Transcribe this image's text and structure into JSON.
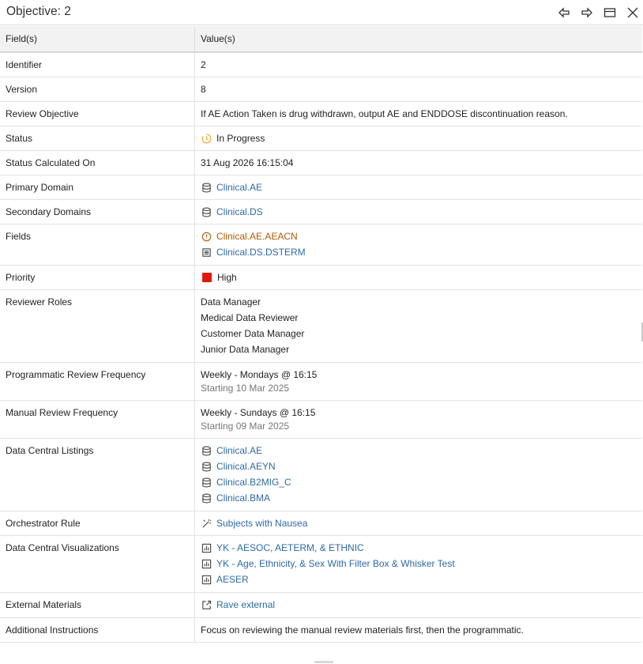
{
  "panel": {
    "title": "Objective: 2"
  },
  "table": {
    "header_field": "Field(s)",
    "header_value": "Value(s)",
    "identifier": {
      "label": "Identifier",
      "value": "2"
    },
    "version": {
      "label": "Version",
      "value": "8"
    },
    "review_objective": {
      "label": "Review Objective",
      "value": "If AE Action Taken is drug withdrawn, output AE and ENDDOSE discontinuation reason."
    },
    "status": {
      "label": "Status",
      "value": "In Progress",
      "icon": "in-progress-clock-icon",
      "color": "#f0a020"
    },
    "status_calculated": {
      "label": "Status Calculated On",
      "value": "31 Aug 2026 16:15:04"
    },
    "primary_domain": {
      "label": "Primary Domain",
      "value": "Clinical.AE",
      "icon": "database-icon"
    },
    "secondary_domains": {
      "label": "Secondary Domains",
      "value": "Clinical.DS",
      "icon": "database-icon"
    },
    "fields": {
      "label": "Fields",
      "items": [
        {
          "value": "Clinical.AE.AEACN",
          "icon": "warning-circle-icon",
          "color": "#b25a00"
        },
        {
          "value": "Clinical.DS.DSTERM",
          "icon": "field-list-icon",
          "color": "#2e6aa6"
        }
      ]
    },
    "priority": {
      "label": "Priority",
      "value": "High",
      "color": "#e0190f"
    },
    "reviewer_roles": {
      "label": "Reviewer Roles",
      "items": [
        "Data Manager",
        "Medical Data Reviewer",
        "Customer Data Manager",
        "Junior Data Manager"
      ]
    },
    "programmatic_frequency": {
      "label": "Programmatic Review Frequency",
      "value": "Weekly - Mondays @ 16:15",
      "sub": "Starting 10 Mar 2025"
    },
    "manual_frequency": {
      "label": "Manual Review Frequency",
      "value": "Weekly - Sundays @ 16:15",
      "sub": "Starting 09 Mar 2025"
    },
    "listings": {
      "label": "Data Central Listings",
      "items": [
        "Clinical.AE",
        "Clinical.AEYN",
        "Clinical.B2MIG_C",
        "Clinical.BMA"
      ]
    },
    "orchestrator_rule": {
      "label": "Orchestrator Rule",
      "value": "Subjects with Nausea",
      "icon": "magic-wand-icon"
    },
    "visualizations": {
      "label": "Data Central Visualizations",
      "items": [
        "YK - AESOC, AETERM, & ETHNIC",
        "YK - Age, Ethnicity, & Sex With Filter Box & Whisker Test",
        "AESER"
      ]
    },
    "external_materials": {
      "label": "External Materials",
      "value": "Rave external",
      "icon": "external-link-icon"
    },
    "additional_instructions": {
      "label": "Additional Instructions",
      "value": "Focus on reviewing the manual review materials first, then the programmatic."
    }
  },
  "colors": {
    "link": "#2e6aa6",
    "warning": "#b25a00",
    "border": "#e2e2e2",
    "header_bg": "#f2f2f2"
  }
}
